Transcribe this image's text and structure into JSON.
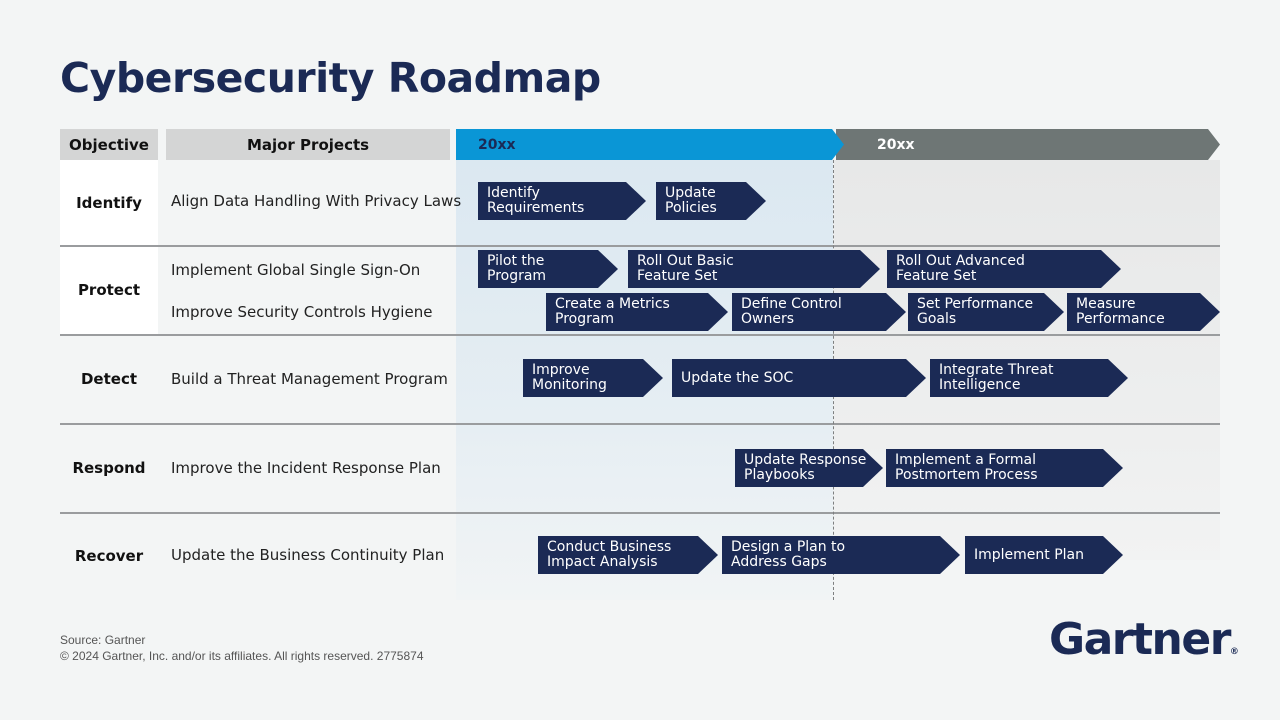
{
  "title": "Cybersecurity Roadmap",
  "header": {
    "objective": "Objective",
    "major_projects": "Major Projects",
    "periods": [
      {
        "label": "20xx",
        "color": "#0a96d6",
        "text_color": "#1b2a55"
      },
      {
        "label": "20xx",
        "color": "#6e7675",
        "text_color": "#ffffff"
      }
    ]
  },
  "colors": {
    "navy": "#1b2a55",
    "period1_bg": "#dde9f1",
    "period2_bg": "#e8e9e9"
  },
  "rows": [
    {
      "objective": "Identify",
      "projects": [
        "Align Data Handling With Privacy Laws"
      ],
      "tasks": [
        {
          "label": "Identify\nRequirements"
        },
        {
          "label": "Update\nPolicies"
        }
      ]
    },
    {
      "objective": "Protect",
      "projects": [
        "Implement Global Single Sign-On",
        "Improve Security Controls Hygiene"
      ],
      "tasks": [
        {
          "label": "Pilot the\nProgram"
        },
        {
          "label": "Roll Out Basic\nFeature Set"
        },
        {
          "label": "Roll Out Advanced\nFeature Set"
        },
        {
          "label": "Create a Metrics\nProgram"
        },
        {
          "label": "Define Control\nOwners"
        },
        {
          "label": "Set Performance\nGoals"
        },
        {
          "label": "Measure\nPerformance"
        }
      ]
    },
    {
      "objective": "Detect",
      "projects": [
        "Build a Threat Management Program"
      ],
      "tasks": [
        {
          "label": "Improve\nMonitoring"
        },
        {
          "label": "Update the SOC"
        },
        {
          "label": "Integrate Threat\nIntelligence"
        }
      ]
    },
    {
      "objective": "Respond",
      "projects": [
        "Improve the Incident Response Plan"
      ],
      "tasks": [
        {
          "label": "Update Response\nPlaybooks"
        },
        {
          "label": "Implement a Formal\nPostmortem Process"
        }
      ]
    },
    {
      "objective": "Recover",
      "projects": [
        "Update the Business Continuity Plan"
      ],
      "tasks": [
        {
          "label": "Conduct Business\nImpact Analysis"
        },
        {
          "label": "Design a Plan to\nAddress Gaps"
        },
        {
          "label": "Implement Plan"
        }
      ]
    }
  ],
  "footer": {
    "source": "Source: Gartner",
    "copyright": "© 2024 Gartner, Inc. and/or its affiliates. All rights reserved. 2775874"
  },
  "logo": {
    "text": "Gartner",
    "reg": "®"
  }
}
